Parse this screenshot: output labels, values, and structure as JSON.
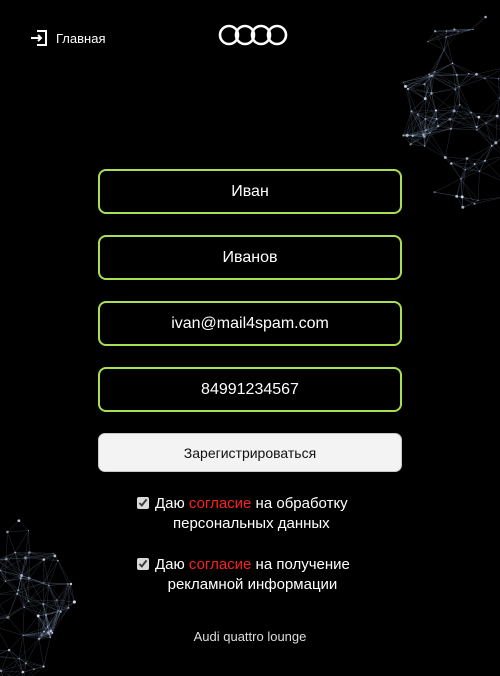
{
  "nav": {
    "home_label": "Главная",
    "home_icon": "sign-in-icon"
  },
  "brand": {
    "logo_icon": "audi-rings-logo-icon"
  },
  "form": {
    "first_name_value": "Иван",
    "last_name_value": "Иванов",
    "email_value": "ivan@mail4spam.com",
    "phone_value": "84991234567",
    "submit_label": "Зарегистрироваться"
  },
  "consents": [
    {
      "checked": true,
      "prefix": "Даю ",
      "accent": "согласие",
      "line1_suffix": " на обработку",
      "line2": "персональных данных"
    },
    {
      "checked": true,
      "prefix": "Даю ",
      "accent": "согласие",
      "line1_suffix": " на получение",
      "line2": "рекламной информации"
    }
  ],
  "footer": {
    "text": "Audi quattro lounge"
  },
  "colors": {
    "background": "#000000",
    "field_border": "#a9df52",
    "accent_red": "#ff1f1f",
    "button_bg": "#f3f3f3"
  }
}
